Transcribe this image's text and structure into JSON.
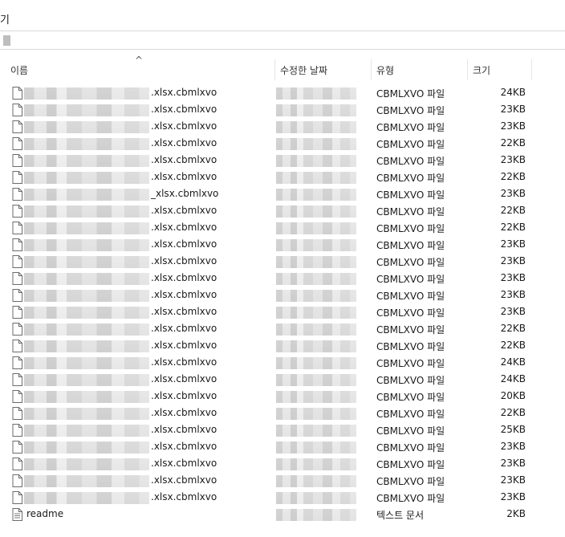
{
  "window": {
    "title": "기"
  },
  "columns": {
    "name": "이름",
    "modified": "수정한 날짜",
    "type": "유형",
    "size": "크기"
  },
  "files": [
    {
      "name": ".xlsx.cbmlxvo",
      "type": "CBMLXVO 파일",
      "size": "24KB"
    },
    {
      "name": ".xlsx.cbmlxvo",
      "type": "CBMLXVO 파일",
      "size": "23KB"
    },
    {
      "name": ".xlsx.cbmlxvo",
      "type": "CBMLXVO 파일",
      "size": "23KB"
    },
    {
      "name": ".xlsx.cbmlxvo",
      "type": "CBMLXVO 파일",
      "size": "22KB"
    },
    {
      "name": ".xlsx.cbmlxvo",
      "type": "CBMLXVO 파일",
      "size": "23KB"
    },
    {
      "name": ".xlsx.cbmlxvo",
      "type": "CBMLXVO 파일",
      "size": "22KB"
    },
    {
      "name": "_xlsx.cbmlxvo",
      "type": "CBMLXVO 파일",
      "size": "23KB"
    },
    {
      "name": ".xlsx.cbmlxvo",
      "type": "CBMLXVO 파일",
      "size": "22KB"
    },
    {
      "name": ".xlsx.cbmlxvo",
      "type": "CBMLXVO 파일",
      "size": "22KB"
    },
    {
      "name": ".xlsx.cbmlxvo",
      "type": "CBMLXVO 파일",
      "size": "23KB"
    },
    {
      "name": ".xlsx.cbmlxvo",
      "type": "CBMLXVO 파일",
      "size": "23KB"
    },
    {
      "name": ".xlsx.cbmlxvo",
      "type": "CBMLXVO 파일",
      "size": "23KB"
    },
    {
      "name": ".xlsx.cbmlxvo",
      "type": "CBMLXVO 파일",
      "size": "23KB"
    },
    {
      "name": ".xlsx.cbmlxvo",
      "type": "CBMLXVO 파일",
      "size": "23KB"
    },
    {
      "name": ".xlsx.cbmlxvo",
      "type": "CBMLXVO 파일",
      "size": "22KB"
    },
    {
      "name": ".xlsx.cbmlxvo",
      "type": "CBMLXVO 파일",
      "size": "22KB"
    },
    {
      "name": ".xlsx.cbmlxvo",
      "type": "CBMLXVO 파일",
      "size": "24KB"
    },
    {
      "name": ".xlsx.cbmlxvo",
      "type": "CBMLXVO 파일",
      "size": "24KB"
    },
    {
      "name": ".xlsx.cbmlxvo",
      "type": "CBMLXVO 파일",
      "size": "20KB"
    },
    {
      "name": ".xlsx.cbmlxvo",
      "type": "CBMLXVO 파일",
      "size": "22KB"
    },
    {
      "name": ".xlsx.cbmlxvo",
      "type": "CBMLXVO 파일",
      "size": "25KB"
    },
    {
      "name": ".xlsx.cbmlxvo",
      "type": "CBMLXVO 파일",
      "size": "23KB"
    },
    {
      "name": ".xlsx.cbmlxvo",
      "type": "CBMLXVO 파일",
      "size": "23KB"
    },
    {
      "name": ".xlsx.cbmlxvo",
      "type": "CBMLXVO 파일",
      "size": "23KB"
    },
    {
      "name": ".xlsx.cbmlxvo",
      "type": "CBMLXVO 파일",
      "size": "23KB"
    },
    {
      "name": "readme",
      "type": "텍스트 문서",
      "size": "2KB",
      "icon": "text-document-icon",
      "name_visible": true
    }
  ]
}
